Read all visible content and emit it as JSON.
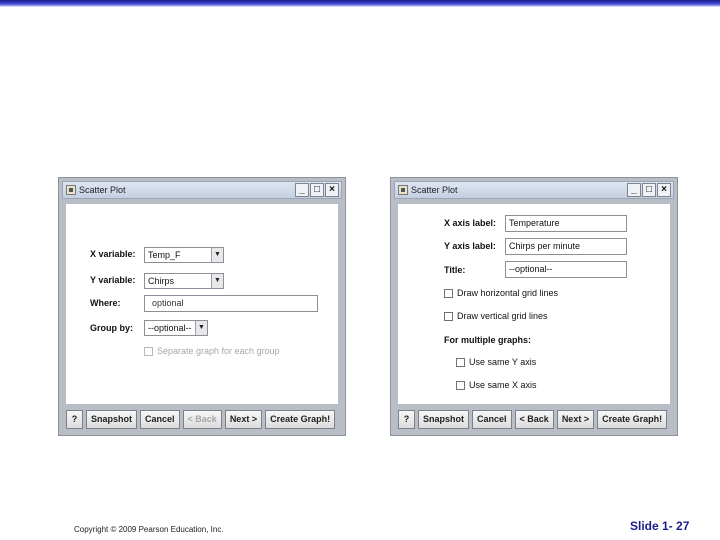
{
  "left_window": {
    "title": "Scatter Plot",
    "win_buttons": [
      "_",
      "□",
      "×"
    ],
    "x_variable": {
      "label": "X variable:",
      "value": "Temp_F"
    },
    "y_variable": {
      "label": "Y variable:",
      "value": "Chirps"
    },
    "where": {
      "label": "Where:",
      "value": "optional"
    },
    "group_by": {
      "label": "Group by:",
      "value": "--optional--"
    },
    "separate_graph": {
      "label": "Separate graph for each group",
      "checked": false,
      "enabled": false
    },
    "buttons": {
      "help": "?",
      "snapshot": "Snapshot",
      "cancel": "Cancel",
      "back": "< Back",
      "next": "Next >",
      "create": "Create Graph!"
    }
  },
  "right_window": {
    "title": "Scatter Plot",
    "win_buttons": [
      "_",
      "□",
      "×"
    ],
    "x_axis_label": {
      "label": "X axis label:",
      "value": "Temperature"
    },
    "y_axis_label": {
      "label": "Y axis label:",
      "value": "Chirps per minute"
    },
    "title_field": {
      "label": "Title:",
      "value": "--optional--"
    },
    "horizontal_grid": {
      "label": "Draw horizontal grid lines",
      "checked": false
    },
    "vertical_grid": {
      "label": "Draw vertical grid lines",
      "checked": false
    },
    "multiple_graphs": {
      "label": "For multiple graphs:"
    },
    "same_y": {
      "label": "Use same Y axis",
      "checked": false
    },
    "same_x": {
      "label": "Use same X axis",
      "checked": false
    },
    "buttons": {
      "help": "?",
      "snapshot": "Snapshot",
      "cancel": "Cancel",
      "back": "< Back",
      "next": "Next >",
      "create": "Create Graph!"
    }
  },
  "footer": {
    "copyright": "Copyright © 2009 Pearson Education, Inc.",
    "slide_number": "Slide 1- 27"
  },
  "colors": {
    "accent": "#1a1f8c",
    "window_frame": "#b9bec6"
  }
}
